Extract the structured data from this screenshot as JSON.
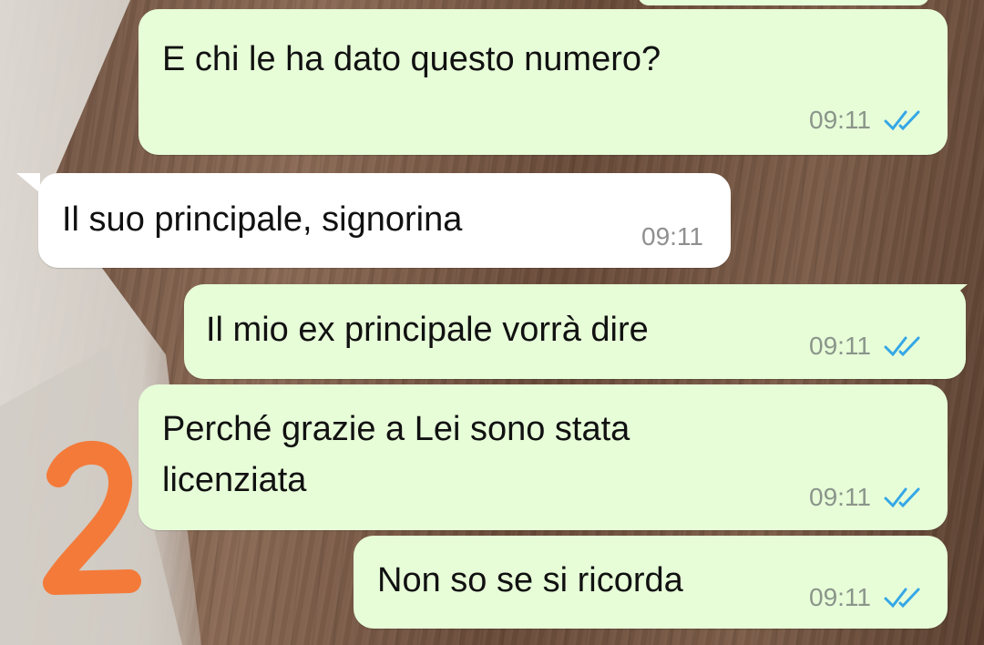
{
  "messages": [
    {
      "direction": "outgoing",
      "text": "E chi le ha dato questo numero?",
      "time": "09:11",
      "status": "read"
    },
    {
      "direction": "incoming",
      "text": "Il suo principale, signorina",
      "time": "09:11"
    },
    {
      "direction": "outgoing",
      "text": "Il mio ex principale vorrà dire",
      "time": "09:11",
      "status": "read"
    },
    {
      "direction": "outgoing",
      "text_line1": "Perché grazie a Lei sono stata",
      "text_line2": "licenziata",
      "time": "09:11",
      "status": "read"
    },
    {
      "direction": "outgoing",
      "text": "Non so se si ricorda",
      "time": "09:11",
      "status": "read"
    }
  ],
  "annotation": {
    "glyph": "2",
    "color": "#f47a3a"
  },
  "colors": {
    "outgoing_bubble": "#e7fdd8",
    "incoming_bubble": "#ffffff",
    "read_ticks": "#35a7e6"
  },
  "icons": {
    "read_receipt": "double-check-icon"
  }
}
